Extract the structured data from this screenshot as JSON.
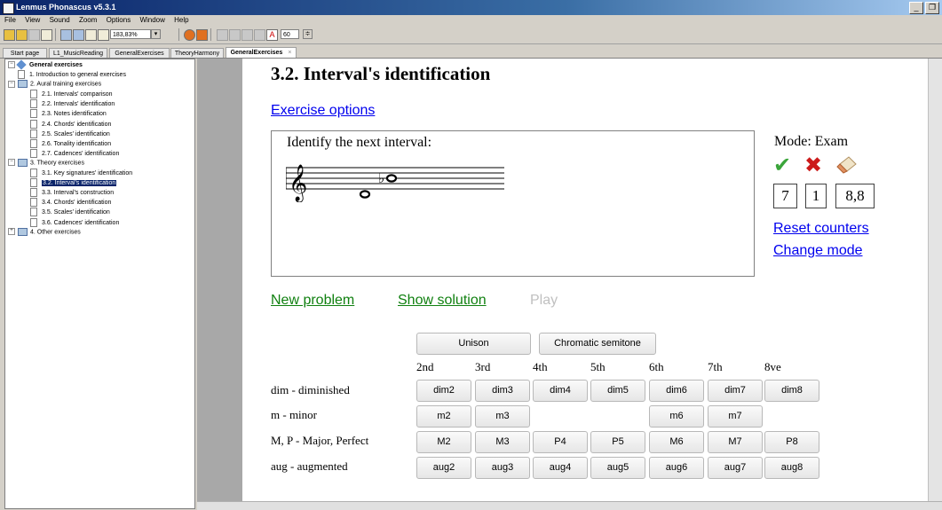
{
  "window": {
    "title": "Lenmus Phonascus v5.3.1"
  },
  "menu": [
    "File",
    "View",
    "Sound",
    "Zoom",
    "Options",
    "Window",
    "Help"
  ],
  "toolbar": {
    "zoom": "183,83%",
    "metronome": "60"
  },
  "tabs": [
    {
      "label": "Start page",
      "active": false
    },
    {
      "label": "L1_MusicReading",
      "active": false
    },
    {
      "label": "GeneralExercises",
      "active": false
    },
    {
      "label": "TheoryHarmony",
      "active": false
    },
    {
      "label": "GeneralExercises",
      "active": true
    }
  ],
  "tree": {
    "root": "General exercises",
    "items": [
      {
        "label": "1. Introduction to general exercises",
        "type": "doc",
        "level": 1
      },
      {
        "label": "2. Aural training exercises",
        "type": "folder",
        "level": 1
      },
      {
        "label": "2.1. Intervals' comparison",
        "type": "doc",
        "level": 2
      },
      {
        "label": "2.2. Intervals' identification",
        "type": "doc",
        "level": 2
      },
      {
        "label": "2.3. Notes identification",
        "type": "doc",
        "level": 2
      },
      {
        "label": "2.4. Chords' identification",
        "type": "doc",
        "level": 2
      },
      {
        "label": "2.5. Scales' identification",
        "type": "doc",
        "level": 2
      },
      {
        "label": "2.6. Tonality identification",
        "type": "doc",
        "level": 2
      },
      {
        "label": "2.7. Cadences' identification",
        "type": "doc",
        "level": 2
      },
      {
        "label": "3. Theory exercises",
        "type": "folder",
        "level": 1
      },
      {
        "label": "3.1. Key signatures' identification",
        "type": "doc",
        "level": 2
      },
      {
        "label": "3.2. Interval's identification",
        "type": "doc",
        "level": 2,
        "selected": true
      },
      {
        "label": "3.3. Interval's construction",
        "type": "doc",
        "level": 2
      },
      {
        "label": "3.4. Chords' identification",
        "type": "doc",
        "level": 2
      },
      {
        "label": "3.5. Scales' identification",
        "type": "doc",
        "level": 2
      },
      {
        "label": "3.6. Cadences' identification",
        "type": "doc",
        "level": 2
      },
      {
        "label": "4. Other exercises",
        "type": "folder",
        "level": 1,
        "collapsed": true
      }
    ]
  },
  "exercise": {
    "title": "3.2. Interval's identification",
    "options_link": "Exercise options",
    "prompt": "Identify the next interval:",
    "mode_label": "Mode: Exam",
    "counters": [
      "7",
      "1",
      "8,8"
    ],
    "reset_link": "Reset counters",
    "change_mode_link": "Change mode",
    "new_problem": "New problem",
    "show_solution": "Show solution",
    "play": "Play"
  },
  "answers": {
    "top_buttons": [
      "Unison",
      "Chromatic semitone"
    ],
    "columns": [
      "2nd",
      "3rd",
      "4th",
      "5th",
      "6th",
      "7th",
      "8ve"
    ],
    "rows": [
      {
        "label": "dim - diminished",
        "buttons": [
          "dim2",
          "dim3",
          "dim4",
          "dim5",
          "dim6",
          "dim7",
          "dim8"
        ]
      },
      {
        "label": "m - minor",
        "buttons": [
          "m2",
          "m3",
          "",
          "",
          "m6",
          "m7",
          ""
        ]
      },
      {
        "label": "M, P - Major, Perfect",
        "buttons": [
          "M2",
          "M3",
          "P4",
          "P5",
          "M6",
          "M7",
          "P8"
        ]
      },
      {
        "label": "aug - augmented",
        "buttons": [
          "aug2",
          "aug3",
          "aug4",
          "aug5",
          "aug6",
          "aug7",
          "aug8"
        ]
      }
    ]
  },
  "colors": {
    "link": "#0000ee",
    "action_link": "#108010",
    "correct": "#3aa53a",
    "wrong": "#cc1a1a"
  }
}
